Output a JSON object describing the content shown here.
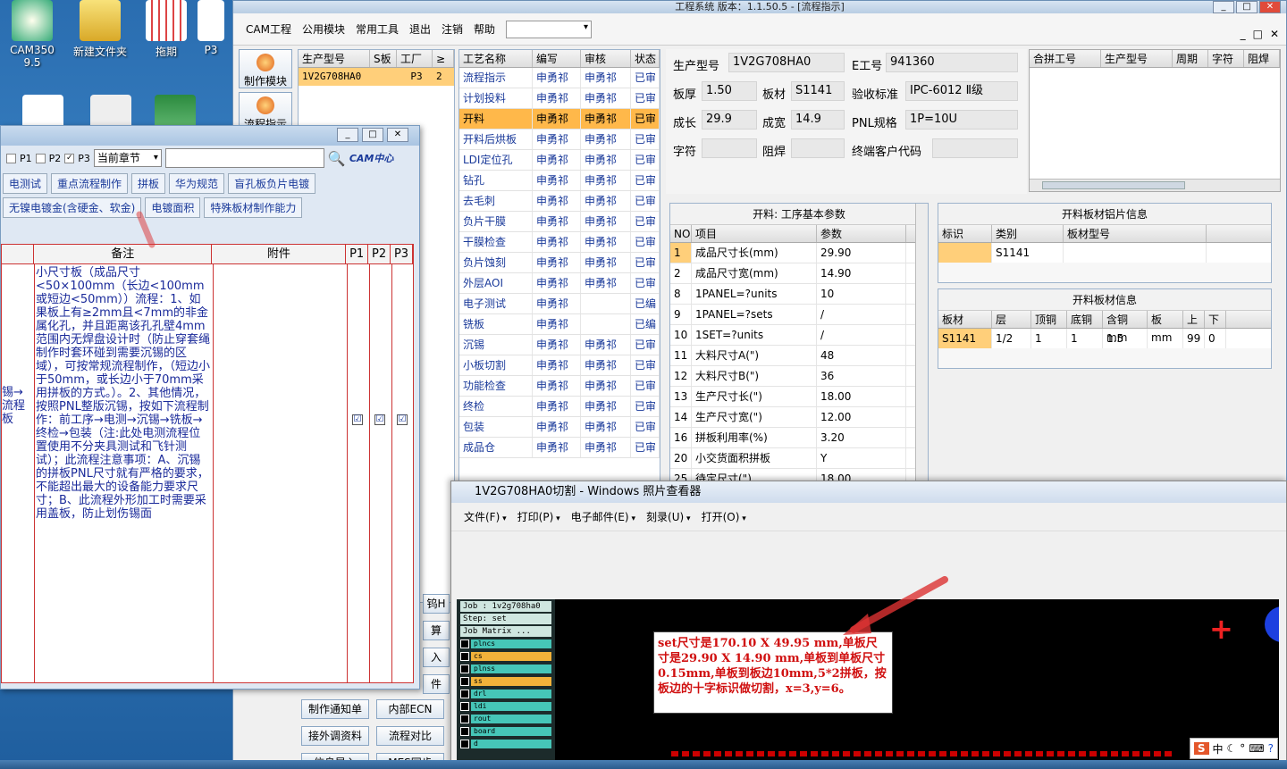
{
  "desktop": {
    "icons": [
      {
        "label": "CAM350 9.5"
      },
      {
        "label": "新建文件夹"
      },
      {
        "label": "拖期"
      },
      {
        "label": "P3"
      }
    ]
  },
  "app": {
    "title": "工程系统  版本：1.1.50.5 - [流程指示]",
    "menu": [
      "CAM工程",
      "公用模块",
      "常用工具",
      "退出",
      "注销",
      "帮助"
    ],
    "mdi_buttons": [
      "_",
      "□",
      "✕"
    ],
    "tools": [
      {
        "label": "制作模块"
      },
      {
        "label": "流程指示"
      }
    ],
    "orders": {
      "headers": [
        "生产型号",
        "S板",
        "工厂",
        "≥"
      ],
      "row": [
        "1V2G708HA0",
        "",
        "P3",
        "2"
      ]
    },
    "process": {
      "headers": [
        "工艺名称",
        "编写",
        "审核",
        "状态"
      ],
      "rows": [
        [
          "流程指示",
          "申勇祁",
          "申勇祁",
          "已审"
        ],
        [
          "计划投料",
          "申勇祁",
          "申勇祁",
          "已审"
        ],
        [
          "开料",
          "申勇祁",
          "申勇祁",
          "已审"
        ],
        [
          "开料后烘板",
          "申勇祁",
          "申勇祁",
          "已审"
        ],
        [
          "LDI定位孔",
          "申勇祁",
          "申勇祁",
          "已审"
        ],
        [
          "钻孔",
          "申勇祁",
          "申勇祁",
          "已审"
        ],
        [
          "去毛刺",
          "申勇祁",
          "申勇祁",
          "已审"
        ],
        [
          "负片干膜",
          "申勇祁",
          "申勇祁",
          "已审"
        ],
        [
          "干膜检查",
          "申勇祁",
          "申勇祁",
          "已审"
        ],
        [
          "负片蚀刻",
          "申勇祁",
          "申勇祁",
          "已审"
        ],
        [
          "外层AOI",
          "申勇祁",
          "申勇祁",
          "已审"
        ],
        [
          "电子测试",
          "申勇祁",
          "",
          "已编"
        ],
        [
          "铣板",
          "申勇祁",
          "",
          "已编"
        ],
        [
          "沉锡",
          "申勇祁",
          "申勇祁",
          "已审"
        ],
        [
          "小板切割",
          "申勇祁",
          "申勇祁",
          "已审"
        ],
        [
          "功能检查",
          "申勇祁",
          "申勇祁",
          "已审"
        ],
        [
          "终检",
          "申勇祁",
          "申勇祁",
          "已审"
        ],
        [
          "包装",
          "申勇祁",
          "申勇祁",
          "已审"
        ],
        [
          "成品仓",
          "申勇祁",
          "申勇祁",
          "已审"
        ]
      ],
      "selected_index": 2
    },
    "info": {
      "model_label": "生产型号",
      "model": "1V2G708HA0",
      "e_label": "E工号",
      "e": "941360",
      "thick_label": "板厚",
      "thick": "1.50",
      "mat_label": "板材",
      "mat": "S1141",
      "accept_label": "验收标准",
      "accept": "IPC-6012 Ⅱ级",
      "len_label": "成长",
      "len": "29.9",
      "wid_label": "成宽",
      "wid": "14.9",
      "pnl_label": "PNL规格",
      "pnl": "1P=10U",
      "char_label": "字符",
      "char": "",
      "mask_label": "阻焊",
      "mask": "",
      "cust_label": "终端客户代码",
      "cust": ""
    },
    "merge": {
      "headers": [
        "合拼工号",
        "生产型号",
        "周期",
        "字符",
        "阻焊"
      ]
    },
    "params": {
      "title": "开料: 工序基本参数",
      "headers": [
        "NO",
        "项目",
        "参数"
      ],
      "rows": [
        [
          "1",
          "成品尺寸长(mm)",
          "29.90"
        ],
        [
          "2",
          "成品尺寸宽(mm)",
          "14.90"
        ],
        [
          "8",
          "1PANEL=?units",
          "10"
        ],
        [
          "9",
          "1PANEL=?sets",
          "/"
        ],
        [
          "10",
          "1SET=?units",
          "/"
        ],
        [
          "11",
          "大料尺寸A(\")",
          "48"
        ],
        [
          "12",
          "大料尺寸B(\")",
          "36"
        ],
        [
          "13",
          "生产尺寸长(\")",
          "18.00"
        ],
        [
          "14",
          "生产尺寸宽(\")",
          "12.00"
        ],
        [
          "16",
          "拼板利用率(%)",
          "3.20"
        ],
        [
          "20",
          "小交货面积拼板",
          "Y"
        ],
        [
          "25",
          "待定尺寸(\")",
          "18.00"
        ]
      ]
    },
    "mat1": {
      "title": "开料板材铝片信息",
      "headers": [
        "标识",
        "类别",
        "板材型号"
      ],
      "row": [
        "",
        "S1141",
        ""
      ]
    },
    "mat2": {
      "title": "开料板材信息",
      "headers": [
        "板材",
        "层",
        "顶铜",
        "底铜",
        "含铜mm",
        "板mm",
        "上",
        "下"
      ],
      "row": [
        "S1141",
        "1/2",
        "1",
        "1",
        "1.5",
        "",
        "99",
        "0"
      ]
    },
    "bottom_buttons": [
      "制作通知单",
      "内部ECN",
      "接外调资料",
      "流程对比",
      "信息导入",
      "MES同步"
    ],
    "side_frag": [
      "钨H",
      "算",
      "入",
      "件"
    ]
  },
  "cam": {
    "filters": {
      "p1": "P1",
      "p2": "P2",
      "p3": "P3",
      "chapter": "当前章节"
    },
    "logo": "CAM中心",
    "tabs_row1": [
      "电测试",
      "重点流程制作",
      "拼板",
      "华为规范",
      "盲孔板负片电镀"
    ],
    "tabs_row2": [
      "无镍电镀金(含硬金、软金)",
      "电镀面积",
      "特殊板材制作能力"
    ],
    "table_headers": [
      "备注",
      "附件",
      "P1",
      "P2",
      "P3"
    ],
    "left_frag": [
      "锡→",
      "流程",
      "板"
    ],
    "note": "小尺寸板（成品尺寸<50×100mm（长边<100mm或短边<50mm））流程：1、如果板上有≥2mm且<7mm的非金属化孔，并且距离该孔孔壁4mm范围内无焊盘设计时（防止穿套绳制作时套环碰到需要沉锡的区域），可按常规流程制作，（短边小于50mm，或长边小于70mm采用拼板的方式。）。2、其他情况，按照PNL整版沉锡，按如下流程制作：前工序→电测→沉锡→铣板→终检→包装（注:此处电测流程位置使用不分夹具测试和飞针测试）；此流程注意事项：A、沉锡的拼板PNL尺寸就有严格的要求，不能超出最大的设备能力要求尺寸；B、此流程外形加工时需要采用盖板，防止划伤锡面",
    "checks": [
      "☑",
      "☑",
      "☑"
    ]
  },
  "viewer": {
    "title": "1V2G708HA0切割 - Windows 照片查看器",
    "menu": [
      "文件(F)",
      "打印(P)",
      "电子邮件(E)",
      "刻录(U)",
      "打开(O)"
    ],
    "job": "Job : 1v2g708ha0",
    "step": "Step: set",
    "matrix": "Job Matrix ...",
    "layers": [
      {
        "name": "plncs",
        "color": "#46c6b8"
      },
      {
        "name": "cs",
        "color": "#f2b23a"
      },
      {
        "name": "plnss",
        "color": "#46c6b8"
      },
      {
        "name": "ss",
        "color": "#f2b23a"
      },
      {
        "name": "drl",
        "color": "#46c6b8"
      },
      {
        "name": "ldi",
        "color": "#46c6b8"
      },
      {
        "name": "rout",
        "color": "#46c6b8"
      },
      {
        "name": "board",
        "color": "#46c6b8"
      },
      {
        "name": "d",
        "color": "#46c6b8"
      }
    ],
    "annotation": "set尺寸是170.10 X 49.95 mm,单板尺寸是29.90 X 14.90 mm,单板到单板尺寸0.15mm,单板到板边10mm,5*2拼板，按板边的十字标识做切割，x=3,y=6。"
  },
  "ime": {
    "label": "中"
  }
}
